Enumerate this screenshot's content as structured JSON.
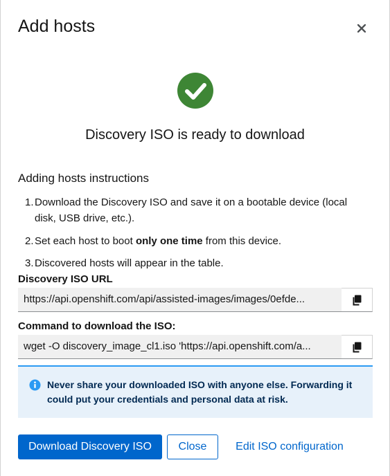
{
  "modal": {
    "title": "Add hosts",
    "ready_title": "Discovery ISO is ready to download"
  },
  "instructions": {
    "title": "Adding hosts instructions",
    "steps": [
      {
        "num": "1.",
        "text": "Download the Discovery ISO and save it on a bootable device (local disk, USB drive, etc.)."
      },
      {
        "num": "2.",
        "pre": "Set each host to boot ",
        "bold": "only one time",
        "post": " from this device."
      },
      {
        "num": "3.",
        "text": "Discovered hosts will appear in the table."
      }
    ]
  },
  "iso_url": {
    "label": "Discovery ISO URL",
    "value": "https://api.openshift.com/api/assisted-images/images/0efde..."
  },
  "command": {
    "label": "Command to download the ISO:",
    "value": "wget -O discovery_image_cl1.iso 'https://api.openshift.com/a..."
  },
  "alert": {
    "text": "Never share your downloaded ISO with anyone else. Forwarding it could put your credentials and personal data at risk."
  },
  "footer": {
    "download_label": "Download Discovery ISO",
    "close_label": "Close",
    "edit_label": "Edit ISO configuration"
  },
  "colors": {
    "success": "#3e8635",
    "primary": "#0066cc",
    "info": "#2b9af3",
    "alert_bg": "#e7f1fa"
  },
  "icons": {
    "close": "close-icon",
    "success": "check-circle-icon",
    "copy": "copy-icon",
    "info": "info-circle-icon"
  }
}
